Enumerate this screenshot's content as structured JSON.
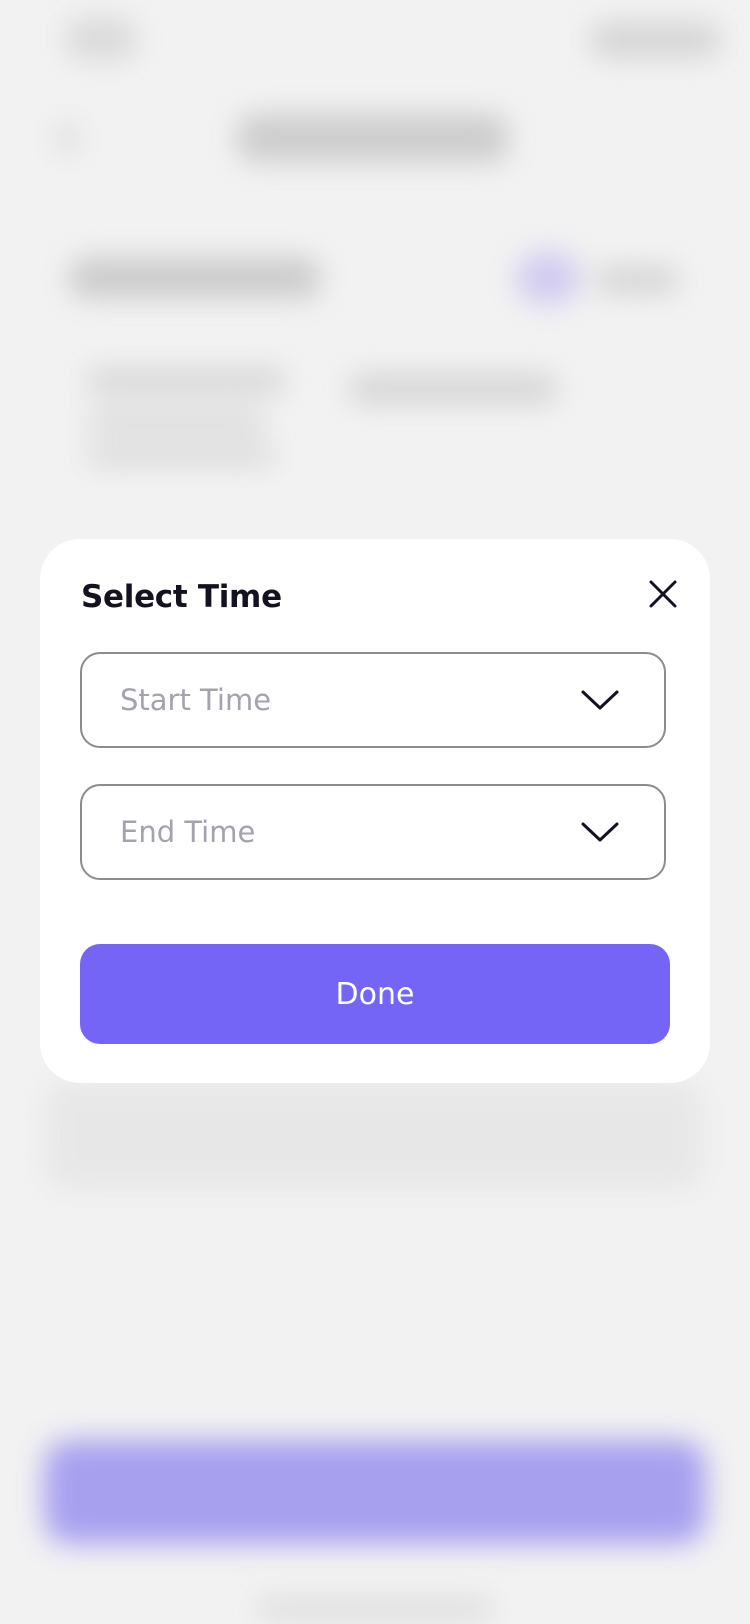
{
  "modal": {
    "title": "Select Time",
    "close_icon": "close-icon",
    "start_time": {
      "placeholder": "Start Time",
      "icon": "chevron-down-icon"
    },
    "end_time": {
      "placeholder": "End Time",
      "icon": "chevron-down-icon"
    },
    "done_label": "Done"
  },
  "colors": {
    "accent": "#7565f6",
    "title_text": "#141221",
    "placeholder_text": "#a4a3ad",
    "field_border": "#8c8c8c",
    "background": "#f2f2f2"
  }
}
